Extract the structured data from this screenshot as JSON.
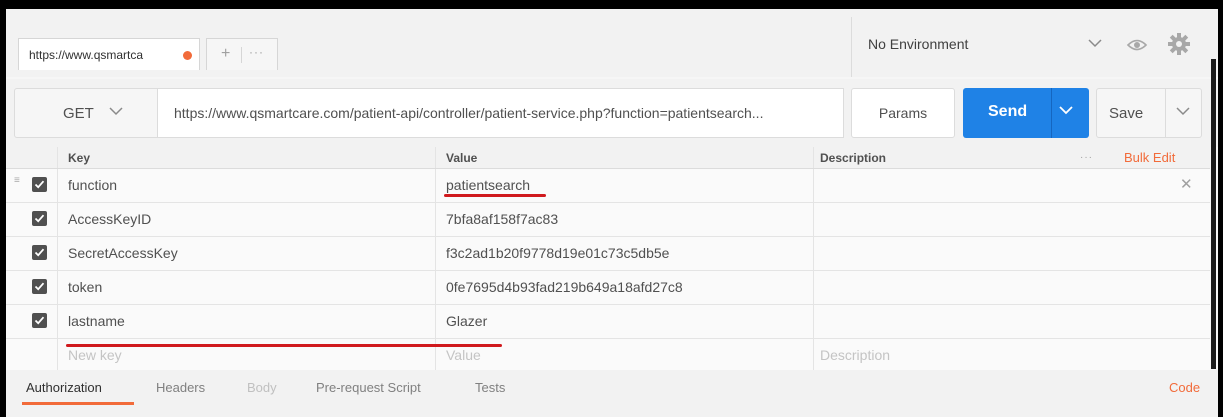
{
  "tab": {
    "title": "https://www.qsmartca",
    "more": "···",
    "plus": "+"
  },
  "environment": {
    "selected": "No Environment"
  },
  "request": {
    "method": "GET",
    "url": "https://www.qsmartcare.com/patient-api/controller/patient-service.php?function=patientsearch...",
    "params_label": "Params",
    "send_label": "Send",
    "save_label": "Save"
  },
  "table": {
    "headers": {
      "key": "Key",
      "value": "Value",
      "description": "Description",
      "bulk_edit": "Bulk Edit",
      "more": "···"
    },
    "rows": [
      {
        "key": "function",
        "value": "patientsearch",
        "checked": true
      },
      {
        "key": "AccessKeyID",
        "value": "7bfa8af158f7ac83",
        "checked": true
      },
      {
        "key": "SecretAccessKey",
        "value": "f3c2ad1b20f9778d19e01c73c5db5e",
        "checked": true
      },
      {
        "key": "token",
        "value": "0fe7695d4b93fad219b649a18afd27c8",
        "checked": true
      },
      {
        "key": "lastname",
        "value": "Glazer",
        "checked": true
      }
    ],
    "new_row": {
      "key": "New key",
      "value": "Value",
      "description": "Description"
    }
  },
  "bottom_tabs": {
    "items": [
      "Authorization",
      "Headers",
      "Body",
      "Pre-request Script",
      "Tests"
    ],
    "active": "Authorization",
    "code_link": "Code"
  },
  "colors": {
    "accent": "#f26b3a",
    "send": "#1f82e6",
    "annotation": "#d0191d"
  }
}
